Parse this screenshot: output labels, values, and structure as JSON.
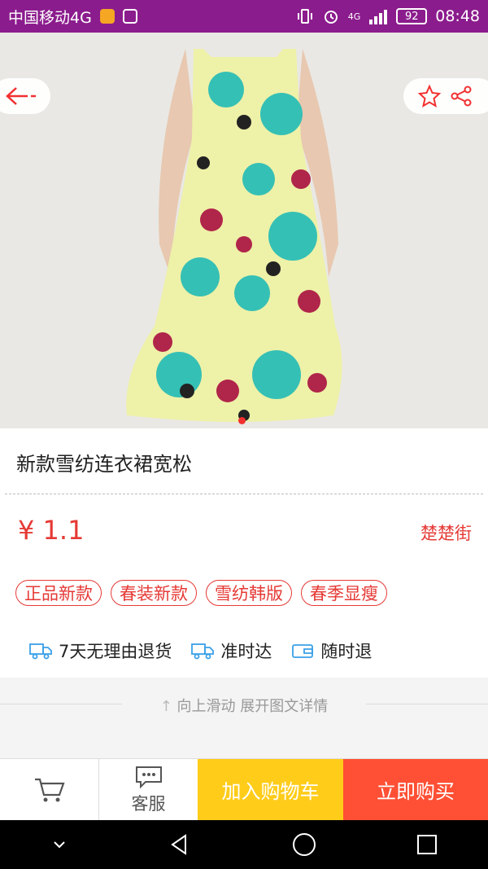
{
  "status_bar": {
    "carrier": "中国移动4G",
    "battery": "92",
    "time": "08:48",
    "network": "4G"
  },
  "product": {
    "title": "新款雪纺连衣裙宽松",
    "price": "¥ 1.1",
    "shop": "楚楚街",
    "tags": [
      "正品新款",
      "春装新款",
      "雪纺韩版",
      "春季显瘦"
    ],
    "services": [
      "7天无理由退货",
      "准时达",
      "随时退"
    ]
  },
  "swipe_hint": "向上滑动 展开图文详情",
  "bottom_bar": {
    "customer_service": "客服",
    "add_to_cart": "加入购物车",
    "buy_now": "立即购买"
  },
  "colors": {
    "accent": "#e53935",
    "status_bar": "#8b1c8d",
    "add_to_cart": "#ffcc1a",
    "buy_now": "#ff4f34"
  },
  "icons": [
    "back-arrow-icon",
    "star-icon",
    "share-icon",
    "truck-icon",
    "wallet-icon",
    "cart-icon",
    "chat-icon",
    "arrow-up-icon"
  ]
}
